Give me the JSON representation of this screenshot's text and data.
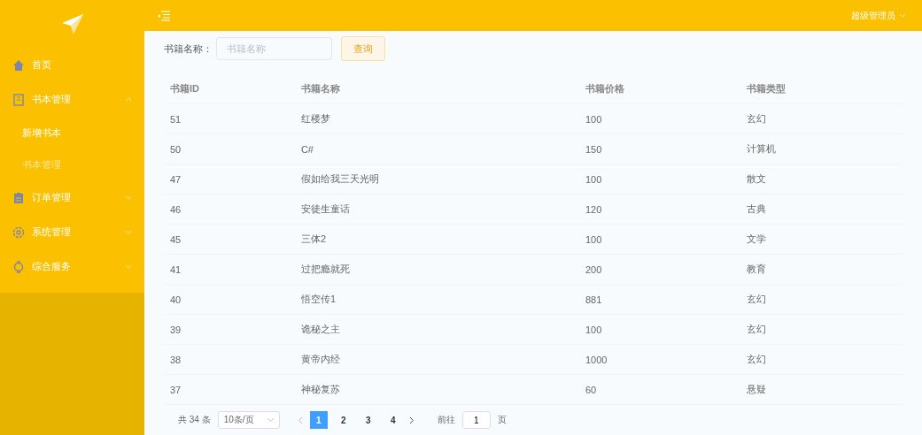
{
  "sidebar": {
    "items": [
      {
        "label": "首页",
        "kind": "link"
      },
      {
        "label": "书本管理",
        "kind": "submenu",
        "expanded": true,
        "children": [
          {
            "label": "新增书本",
            "selected": true
          },
          {
            "label": "书本管理",
            "selected": false
          }
        ]
      },
      {
        "label": "订单管理",
        "kind": "submenu",
        "expanded": false
      },
      {
        "label": "系统管理",
        "kind": "submenu",
        "expanded": false
      },
      {
        "label": "综合服务",
        "kind": "submenu",
        "expanded": false
      }
    ]
  },
  "header": {
    "user": "超级管理员"
  },
  "search": {
    "label": "书籍名称：",
    "placeholder": "书籍名称",
    "button": "查询"
  },
  "table": {
    "columns": [
      "书籍ID",
      "书籍名称",
      "书籍价格",
      "书籍类型"
    ],
    "rows": [
      [
        "51",
        "红楼梦",
        "100",
        "玄幻"
      ],
      [
        "50",
        "C#",
        "150",
        "计算机"
      ],
      [
        "47",
        "假如给我三天光明",
        "100",
        "散文"
      ],
      [
        "46",
        "安徒生童话",
        "120",
        "古典"
      ],
      [
        "45",
        "三体2",
        "100",
        "文学"
      ],
      [
        "41",
        "过把瘾就死",
        "200",
        "教育"
      ],
      [
        "40",
        "悟空传1",
        "881",
        "玄幻"
      ],
      [
        "39",
        "诡秘之主",
        "100",
        "玄幻"
      ],
      [
        "38",
        "黄帝内经",
        "1000",
        "玄幻"
      ],
      [
        "37",
        "神秘复苏",
        "60",
        "悬疑"
      ]
    ]
  },
  "pagination": {
    "total": "共 34 条",
    "page_size": "10条/页",
    "pages": [
      {
        "label": "1",
        "selected": true
      },
      {
        "label": "2",
        "selected": false
      },
      {
        "label": "3",
        "selected": false
      },
      {
        "label": "4",
        "selected": false
      }
    ],
    "goto_label": "前往",
    "goto_value": "1",
    "goto_suffix": "页"
  }
}
